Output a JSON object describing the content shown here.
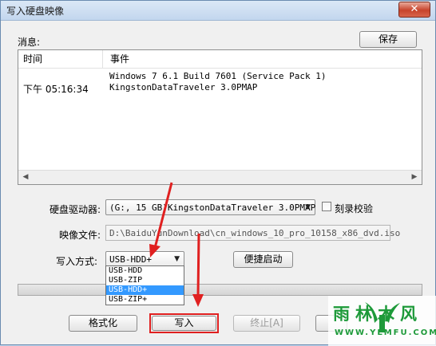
{
  "window": {
    "title": "写入硬盘映像",
    "close_glyph": "✕"
  },
  "messages": {
    "label": "消息:",
    "save_label": "保存",
    "columns": {
      "time": "时间",
      "event": "事件"
    },
    "rows": [
      {
        "time": "",
        "event": "Windows 7 6.1 Build 7601 (Service Pack 1)"
      },
      {
        "time": "下午 05:16:34",
        "event": "KingstonDataTraveler 3.0PMAP"
      }
    ]
  },
  "drive": {
    "label": "硬盘驱动器:",
    "value": "(G:, 15 GB)KingstonDataTraveler 3.0PMAP",
    "verify_label": "刻录校验"
  },
  "image_file": {
    "label": "映像文件:",
    "value": "D:\\BaiduYunDownload\\cn_windows_10_pro_10158_x86_dvd.iso"
  },
  "write_method": {
    "label": "写入方式:",
    "value": "USB-HDD+",
    "options": [
      "USB-HDD",
      "USB-ZIP",
      "USB-HDD+",
      "USB-ZIP+"
    ],
    "selected_index": 2
  },
  "quick_start_label": "便捷启动",
  "buttons": {
    "format": "格式化",
    "write": "写入",
    "stop": "终止[A]"
  },
  "watermark": {
    "brand": "雨林木风",
    "url": "WWW.YLMFU.COM"
  },
  "colors": {
    "annotation_red": "#e02020",
    "selection_blue": "#3399ff"
  }
}
